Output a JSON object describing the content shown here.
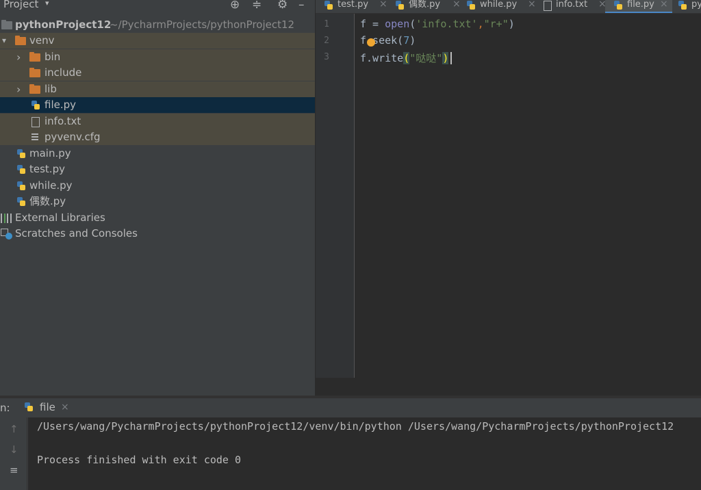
{
  "project_panel": {
    "title": "Project",
    "dropdown_glyph": "▾",
    "icons": [
      "crosshair-icon",
      "collapse-icon",
      "gear-icon",
      "minimize-icon"
    ],
    "tree": [
      {
        "label": "pythonProject12",
        "sub": "~/PycharmProjects/pythonProject12",
        "arrow": "▾",
        "icon": "folder"
      },
      {
        "label": "venv",
        "arrow": "▾",
        "icon": "folder"
      },
      {
        "label": "bin",
        "arrow": "›",
        "icon": "folder"
      },
      {
        "label": "include",
        "arrow": "",
        "icon": "folder"
      },
      {
        "label": "lib",
        "arrow": "›",
        "icon": "folder"
      },
      {
        "label": "file.py",
        "icon": "python-file",
        "selected": true
      },
      {
        "label": "info.txt",
        "icon": "text-file"
      },
      {
        "label": "pyvenv.cfg",
        "icon": "config-file"
      },
      {
        "label": "main.py",
        "icon": "python-file"
      },
      {
        "label": "test.py",
        "icon": "python-file"
      },
      {
        "label": "while.py",
        "icon": "python-file"
      },
      {
        "label": "偶数.py",
        "icon": "python-file"
      },
      {
        "label": "External Libraries",
        "icon": "library"
      },
      {
        "label": "Scratches and Consoles",
        "icon": "scratches"
      }
    ]
  },
  "tabs": [
    {
      "label": "test.py",
      "icon": "python-file"
    },
    {
      "label": "偶数.py",
      "icon": "python-file"
    },
    {
      "label": "while.py",
      "icon": "python-file"
    },
    {
      "label": "info.txt",
      "icon": "text-file"
    },
    {
      "label": "file.py",
      "icon": "python-file",
      "active": true
    },
    {
      "label": "py",
      "icon": "python-file"
    }
  ],
  "editor": {
    "line_numbers": [
      "1",
      "2",
      "3"
    ],
    "lines": [
      "f = open('info.txt',\"r+\")",
      "f.seek(7)",
      "f.write(\"哒哒\")"
    ]
  },
  "run_panel": {
    "label": "n:",
    "tab_label": "file",
    "close_glyph": "×",
    "console": [
      "/Users/wang/PycharmProjects/pythonProject12/venv/bin/python /Users/wang/PycharmProjects/pythonProject12",
      "",
      "Process finished with exit code 0"
    ]
  },
  "colors": {
    "panel_bg": "#3c3f41",
    "editor_bg": "#2b2b2b",
    "selection": "#0d293e",
    "highlight_row": "#4d4a3f",
    "folder": "#cc7832",
    "active_tab_underline": "#4a88c7"
  }
}
